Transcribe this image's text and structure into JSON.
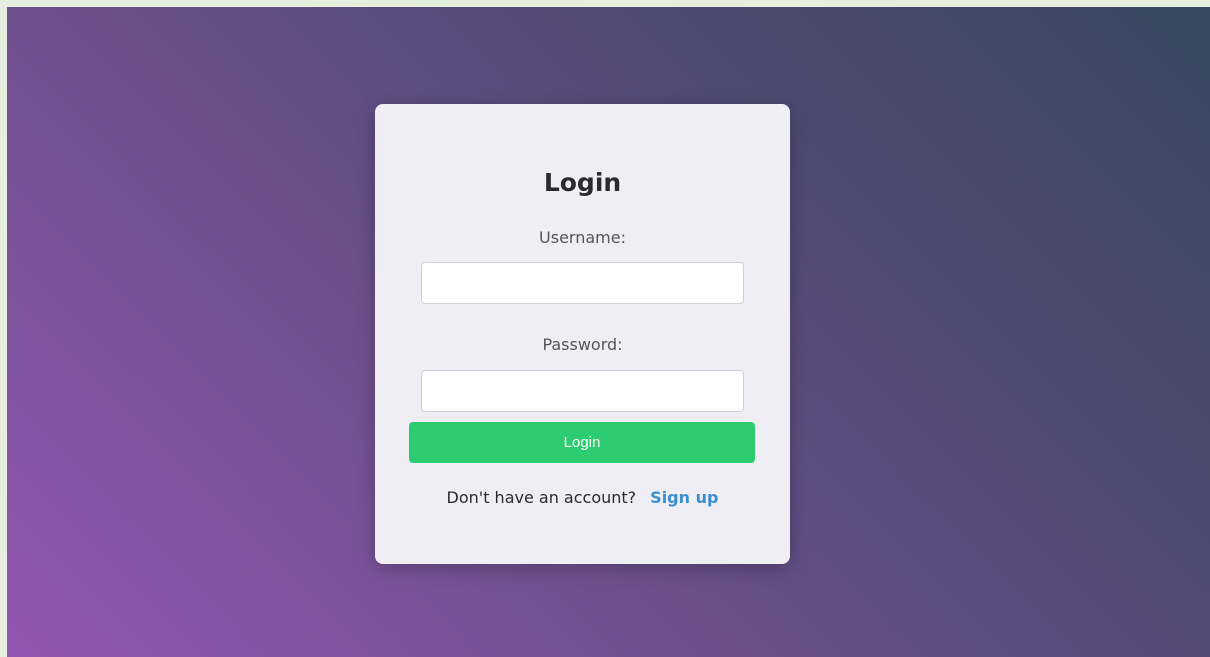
{
  "login_form": {
    "title": "Login",
    "username_label": "Username:",
    "username_value": "",
    "password_label": "Password:",
    "password_value": "",
    "submit_label": "Login",
    "signup_prompt": "Don't have an account?",
    "signup_link": "Sign up"
  },
  "colors": {
    "background_gradient_start": "#9357b1",
    "background_gradient_end": "#384860",
    "card_background": "#efeef4",
    "submit_button": "#2ecc71",
    "signup_link": "#3a8fd1"
  }
}
